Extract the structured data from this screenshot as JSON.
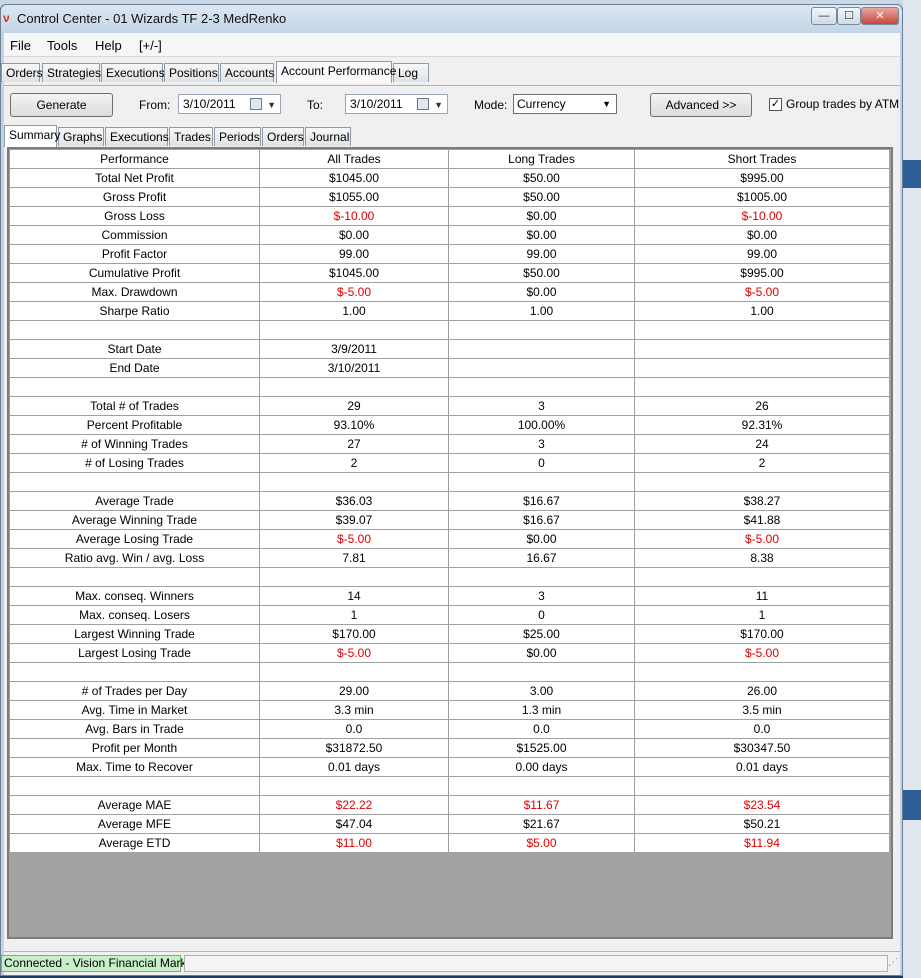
{
  "window": {
    "title": "Control Center - 01 Wizards TF 2-3 MedRenko",
    "controls": {
      "minimize": "—",
      "maximize": "☐",
      "close": "✕"
    }
  },
  "menu": [
    "File",
    "Tools",
    "Help",
    "[+/-]"
  ],
  "main_tabs": [
    "Orders",
    "Strategies",
    "Executions",
    "Positions",
    "Accounts",
    "Account Performance",
    "Log"
  ],
  "main_tab_active": "Account Performance",
  "toolbar": {
    "generate_label": "Generate",
    "from_label": "From:",
    "from_value": "3/10/2011",
    "to_label": "To:",
    "to_value": "3/10/2011",
    "mode_label": "Mode:",
    "mode_value": "Currency",
    "advanced_label": "Advanced >>",
    "group_trades_label": "Group trades by ATM",
    "group_trades_checked": true
  },
  "sub_tabs": [
    "Summary",
    "Graphs",
    "Executions",
    "Trades",
    "Periods",
    "Orders",
    "Journal"
  ],
  "sub_tab_active": "Summary",
  "table": {
    "headers": [
      "Performance",
      "All Trades",
      "Long Trades",
      "Short Trades"
    ],
    "rows": [
      [
        "Total Net Profit",
        "$1045.00",
        "$50.00",
        "$995.00"
      ],
      [
        "Gross Profit",
        "$1055.00",
        "$50.00",
        "$1005.00"
      ],
      [
        "Gross Loss",
        "$-10.00",
        "$0.00",
        "$-10.00"
      ],
      [
        "Commission",
        "$0.00",
        "$0.00",
        "$0.00"
      ],
      [
        "Profit Factor",
        "99.00",
        "99.00",
        "99.00"
      ],
      [
        "Cumulative Profit",
        "$1045.00",
        "$50.00",
        "$995.00"
      ],
      [
        "Max. Drawdown",
        "$-5.00",
        "$0.00",
        "$-5.00"
      ],
      [
        "Sharpe Ratio",
        "1.00",
        "1.00",
        "1.00"
      ],
      [
        "",
        "",
        "",
        ""
      ],
      [
        "Start Date",
        "3/9/2011",
        "",
        ""
      ],
      [
        "End Date",
        "3/10/2011",
        "",
        ""
      ],
      [
        "",
        "",
        "",
        ""
      ],
      [
        "Total # of Trades",
        "29",
        "3",
        "26"
      ],
      [
        "Percent Profitable",
        "93.10%",
        "100.00%",
        "92.31%"
      ],
      [
        "# of Winning Trades",
        "27",
        "3",
        "24"
      ],
      [
        "# of Losing Trades",
        "2",
        "0",
        "2"
      ],
      [
        "",
        "",
        "",
        ""
      ],
      [
        "Average Trade",
        "$36.03",
        "$16.67",
        "$38.27"
      ],
      [
        "Average Winning Trade",
        "$39.07",
        "$16.67",
        "$41.88"
      ],
      [
        "Average Losing Trade",
        "$-5.00",
        "$0.00",
        "$-5.00"
      ],
      [
        "Ratio avg. Win / avg. Loss",
        "7.81",
        "16.67",
        "8.38"
      ],
      [
        "",
        "",
        "",
        ""
      ],
      [
        "Max. conseq. Winners",
        "14",
        "3",
        "11"
      ],
      [
        "Max. conseq. Losers",
        "1",
        "0",
        "1"
      ],
      [
        "Largest Winning Trade",
        "$170.00",
        "$25.00",
        "$170.00"
      ],
      [
        "Largest Losing Trade",
        "$-5.00",
        "$0.00",
        "$-5.00"
      ],
      [
        "",
        "",
        "",
        ""
      ],
      [
        "# of Trades per Day",
        "29.00",
        "3.00",
        "26.00"
      ],
      [
        "Avg. Time in Market",
        "3.3 min",
        "1.3 min",
        "3.5 min"
      ],
      [
        "Avg. Bars in Trade",
        "0.0",
        "0.0",
        "0.0"
      ],
      [
        "Profit per Month",
        "$31872.50",
        "$1525.00",
        "$30347.50"
      ],
      [
        "Max. Time to Recover",
        "0.01 days",
        "0.00 days",
        "0.01 days"
      ],
      [
        "",
        "",
        "",
        ""
      ],
      [
        "Average MAE",
        "$22.22",
        "$11.67",
        "$23.54"
      ],
      [
        "Average MFE",
        "$47.04",
        "$21.67",
        "$50.21"
      ],
      [
        "Average ETD",
        "$11.00",
        "$5.00",
        "$11.94"
      ]
    ],
    "red_values_rows": [
      "Gross Loss",
      "Max. Drawdown",
      "Average Losing Trade",
      "Largest Losing Trade",
      "Average MAE",
      "Average ETD"
    ]
  },
  "status": {
    "connection": "Connected - Vision Financial Markets"
  },
  "colors": {
    "negative": "#e00000",
    "connected_bg": "#c8f0c8"
  }
}
